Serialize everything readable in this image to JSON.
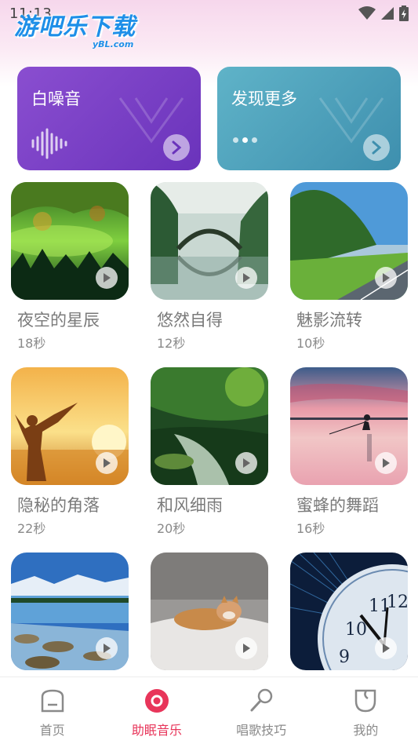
{
  "status_bar": {
    "time": "11:13"
  },
  "watermark": {
    "main": "游吧乐下载",
    "sub": "yBL.com"
  },
  "feature_cards": [
    {
      "title": "白噪音",
      "icon": "waveform-icon",
      "color": "#7a40c6"
    },
    {
      "title": "发现更多",
      "icon": "dots-icon",
      "color": "#4fa0bb"
    }
  ],
  "tracks": [
    {
      "title": "夜空的星辰",
      "duration": "18秒"
    },
    {
      "title": "悠然自得",
      "duration": "12秒"
    },
    {
      "title": "魅影流转",
      "duration": "10秒"
    },
    {
      "title": "隐秘的角落",
      "duration": "22秒"
    },
    {
      "title": "和风细雨",
      "duration": "20秒"
    },
    {
      "title": "蜜蜂的舞蹈",
      "duration": "16秒"
    },
    {
      "title": "",
      "duration": ""
    },
    {
      "title": "",
      "duration": ""
    },
    {
      "title": "",
      "duration": ""
    }
  ],
  "tabbar": {
    "active": "助眠音乐",
    "active_color": "#e8355a",
    "items": [
      {
        "label": "首页",
        "icon": "home-icon"
      },
      {
        "label": "助眠音乐",
        "icon": "record-icon"
      },
      {
        "label": "唱歌技巧",
        "icon": "microphone-icon"
      },
      {
        "label": "我的",
        "icon": "profile-icon"
      }
    ]
  }
}
